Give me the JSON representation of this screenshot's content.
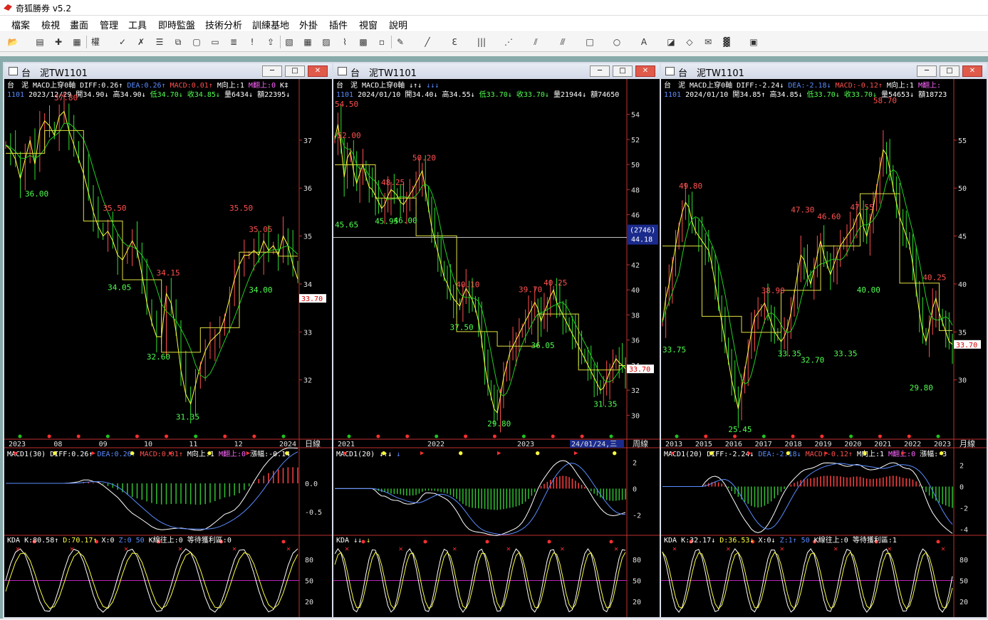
{
  "app": {
    "title": "奇狐勝券 v5.2"
  },
  "menu": [
    "檔案",
    "檢視",
    "畫面",
    "管理",
    "工具",
    "即時監盤",
    "技術分析",
    "訓練基地",
    "外掛",
    "插件",
    "視窗",
    "說明"
  ],
  "toolbar": {
    "icons": [
      "open-icon",
      "table-icon",
      "crosshair-icon",
      "layout-icon",
      "weight-icon",
      "draw-icon",
      "compare-icon",
      "list-icon",
      "copy-icon",
      "doc-icon",
      "alert-icon",
      "stack-icon",
      "warning-icon",
      "export-icon",
      "chart1-icon",
      "grid-icon",
      "chart2-icon",
      "line-chart-icon",
      "chart3-icon",
      "chart4-icon",
      "pen-icon",
      "line-icon",
      "fib-icon",
      "vline-icon",
      "fan-icon",
      "channel-icon",
      "parallel-icon",
      "rect-icon",
      "ellipse-icon",
      "text-icon",
      "eraser-icon",
      "erase2-icon",
      "note-icon",
      "palette-icon",
      "save-icon"
    ],
    "weight_label": "權"
  },
  "windows": [
    {
      "title": "台　泥TW1101",
      "buttons": {
        "min": "─",
        "max": "□",
        "close": "✕"
      },
      "price_info": {
        "name": "台　泥",
        "indicator": "MACD上穿0軸",
        "diff": "DIFF:0.26↑",
        "dea": "DEA:0.26↑",
        "macd": "MACD:0.01↑",
        "m_up": "M向上:1",
        "m_turn": "M翻上:0",
        "k": "K‡",
        "code": "1101",
        "date": "2023/12/29",
        "open": "開34.90↓",
        "high": "高34.90↓",
        "low": "低34.70↓",
        "close": "收34.85↓",
        "vol": "量6434↓",
        "amt": "額22395↓"
      },
      "period_label": "日線",
      "x_labels": [
        "2023",
        "08",
        "09",
        "10",
        "11",
        "12",
        "2024"
      ],
      "y_ticks": [
        "37",
        "36",
        "35",
        "34",
        "33",
        "32"
      ],
      "y_values": [
        37,
        36,
        35,
        34,
        33,
        32
      ],
      "ylim": [
        31.0,
        37.8
      ],
      "current_price": "33.70",
      "price_annotations": [
        {
          "t": "37.80",
          "v": 37.8,
          "i": 12,
          "c": "#ff5050"
        },
        {
          "t": "36.00",
          "v": 36.0,
          "i": 6,
          "c": "#50ff50"
        },
        {
          "t": "35.50",
          "v": 35.5,
          "i": 22,
          "c": "#ff5050"
        },
        {
          "t": "35.50",
          "v": 35.5,
          "i": 48,
          "c": "#ff5050"
        },
        {
          "t": "35.05",
          "v": 35.05,
          "i": 52,
          "c": "#ff5050"
        },
        {
          "t": "34.15",
          "v": 34.15,
          "i": 33,
          "c": "#ff5050"
        },
        {
          "t": "34.05",
          "v": 34.05,
          "i": 23,
          "c": "#50ff50"
        },
        {
          "t": "34.00",
          "v": 34.0,
          "i": 52,
          "c": "#50ff50"
        },
        {
          "t": "32.60",
          "v": 32.6,
          "i": 31,
          "c": "#50ff50"
        },
        {
          "t": "31.35",
          "v": 31.35,
          "i": 37,
          "c": "#50ff50"
        }
      ],
      "series": [
        36.9,
        36.8,
        36.6,
        36.2,
        36.6,
        37.0,
        36.5,
        37.2,
        37.4,
        37.3,
        37.1,
        37.5,
        37.6,
        37.2,
        36.9,
        36.6,
        36.3,
        35.9,
        35.5,
        35.2,
        35.0,
        35.1,
        34.9,
        34.6,
        34.5,
        34.7,
        34.9,
        34.7,
        34.2,
        33.6,
        33.2,
        32.9,
        32.9,
        33.8,
        33.6,
        33.0,
        32.2,
        31.7,
        31.5,
        31.9,
        32.3,
        32.6,
        32.8,
        32.9,
        33.0,
        33.3,
        33.7,
        34.1,
        34.4,
        34.6,
        34.6,
        34.7,
        34.6,
        34.9,
        34.7,
        34.8,
        34.6,
        35.0,
        34.8,
        34.4,
        34.1
      ],
      "macd_header": {
        "name": "MACD1(30)",
        "diff": "DIFF:0.26↑",
        "dea": "DEA:0.26↑",
        "macd": "MACD:0.01↑",
        "m_up": "M向上:1",
        "m_turn": "M翻上:0",
        "amp": "漲幅:-0.14"
      },
      "macd_ticks": [
        "0.0",
        "-0.5"
      ],
      "macd_vals": [
        0.0,
        -0.5
      ],
      "macd_lim": [
        -0.9,
        0.6
      ],
      "kd_header": {
        "name": "KDA",
        "k": "K:80.58↑",
        "d": "D:70.17↑",
        "x": "X:0",
        "z": "Z:0",
        "n50": "50",
        "up": "K線往上:0",
        "wait": "等待獲利區:0"
      },
      "kd_ticks": [
        "80",
        "50",
        "20"
      ]
    },
    {
      "title": "台　泥TW1101",
      "buttons": {
        "min": "─",
        "max": "□",
        "close": "✕"
      },
      "price_info": {
        "name": "台　泥",
        "indicator": "MACD上穿0軸",
        "diff": "↓↑↓",
        "dea": "↓↓↓",
        "macd": "",
        "m_up": "",
        "m_turn": "",
        "k": "",
        "code": "1101",
        "date": "2024/01/10",
        "open": "開34.40↓",
        "high": "高34.55↓",
        "low": "低33.70↓",
        "close": "收33.70↓",
        "vol": "量21944↓",
        "amt": "額74650"
      },
      "period_label": "周線",
      "x_labels": [
        "2021",
        "2022",
        "2023",
        "24/01/24,三"
      ],
      "y_ticks": [
        "54",
        "52",
        "50",
        "48",
        "46",
        "44",
        "42",
        "40",
        "38",
        "36",
        "34",
        "32",
        "30"
      ],
      "y_values": [
        54,
        52,
        50,
        48,
        46,
        44,
        42,
        40,
        38,
        36,
        34,
        32,
        30
      ],
      "ylim": [
        29.0,
        55.0
      ],
      "current_price": "33.70",
      "cursor_value": "(2746)",
      "cursor_price": "44.18",
      "price_annotations": [
        {
          "t": "54.50",
          "v": 54.5,
          "i": 2,
          "c": "#ff5050"
        },
        {
          "t": "52.00",
          "v": 52.0,
          "i": 4,
          "c": "#ff5050"
        },
        {
          "t": "50.20",
          "v": 50.2,
          "i": 28,
          "c": "#ff5050"
        },
        {
          "t": "48.25",
          "v": 48.25,
          "i": 18,
          "c": "#ff5050"
        },
        {
          "t": "45.65",
          "v": 45.65,
          "i": 3,
          "c": "#50ff50"
        },
        {
          "t": "45.95",
          "v": 45.95,
          "i": 16,
          "c": "#50ff50"
        },
        {
          "t": "46.00",
          "v": 46.0,
          "i": 22,
          "c": "#50ff50"
        },
        {
          "t": "40.10",
          "v": 40.1,
          "i": 42,
          "c": "#ff5050"
        },
        {
          "t": "39.70",
          "v": 39.7,
          "i": 62,
          "c": "#ff5050"
        },
        {
          "t": "40.25",
          "v": 40.25,
          "i": 70,
          "c": "#ff5050"
        },
        {
          "t": "37.50",
          "v": 37.5,
          "i": 40,
          "c": "#50ff50"
        },
        {
          "t": "36.05",
          "v": 36.05,
          "i": 66,
          "c": "#50ff50"
        },
        {
          "t": "31.35",
          "v": 31.35,
          "i": 86,
          "c": "#50ff50"
        },
        {
          "t": "29.80",
          "v": 29.8,
          "i": 52,
          "c": "#50ff50"
        }
      ],
      "series": [
        52.0,
        53.2,
        51.5,
        49.0,
        50.5,
        51.0,
        49.5,
        48.5,
        49.3,
        50.0,
        49.0,
        48.2,
        48.0,
        47.5,
        47.0,
        46.5,
        46.8,
        47.5,
        48.0,
        47.8,
        47.5,
        47.0,
        46.8,
        47.2,
        47.6,
        48.0,
        48.5,
        49.0,
        49.5,
        48.0,
        46.5,
        45.0,
        44.0,
        43.0,
        42.0,
        41.0,
        40.5,
        39.8,
        39.3,
        39.0,
        38.7,
        39.5,
        40.1,
        39.7,
        39.2,
        38.5,
        37.5,
        36.0,
        34.0,
        32.5,
        31.5,
        30.5,
        30.2,
        31.5,
        33.0,
        34.0,
        35.0,
        35.5,
        36.0,
        36.5,
        37.0,
        37.5,
        38.0,
        38.5,
        39.0,
        38.5,
        37.5,
        38.2,
        38.8,
        39.5,
        40.0,
        39.0,
        38.5,
        38.0,
        37.5,
        37.0,
        36.5,
        36.0,
        35.5,
        35.0,
        34.5,
        34.0,
        33.5,
        33.0,
        32.5,
        32.0,
        32.2,
        32.8,
        33.5,
        34.0,
        34.5,
        34.2,
        34.0,
        33.7
      ],
      "macd_header": {
        "name": "MACD1(20)",
        "diff": "↓↑↓",
        "dea": "↓",
        "macd": "",
        "m_up": "",
        "m_turn": "",
        "amp": ""
      },
      "macd_ticks": [
        "2",
        "0",
        "-2"
      ],
      "macd_vals": [
        2,
        0,
        -2
      ],
      "macd_lim": [
        -3.5,
        3.0
      ],
      "kd_header": {
        "name": "KDA",
        "k": "↓↓",
        "d": "↓",
        "x": "",
        "z": "",
        "n50": "",
        "up": "",
        "wait": ""
      },
      "kd_ticks": [
        "80",
        "50",
        "20"
      ]
    },
    {
      "title": "台　泥TW1101",
      "buttons": {
        "min": "─",
        "max": "□",
        "close": "✕"
      },
      "price_info": {
        "name": "台　泥",
        "indicator": "MACD上穿0軸",
        "diff": "DIFF:-2.24↓",
        "dea": "DEA:-2.18↓",
        "macd": "MACD:-0.12↑",
        "m_up": "M向上:1",
        "m_turn": "M翻上:",
        "k": "",
        "code": "1101",
        "date": "2024/01/10",
        "open": "開34.85↑",
        "high": "高34.85↓",
        "low": "低33.70↓",
        "close": "收33.70↓",
        "vol": "量54653↓",
        "amt": "額18723"
      },
      "period_label": "月線",
      "x_labels": [
        "2013",
        "2015",
        "2016",
        "2017",
        "2018",
        "2019",
        "2020",
        "2021",
        "2022",
        "2023"
      ],
      "y_ticks": [
        "55",
        "50",
        "45",
        "40",
        "35",
        "30"
      ],
      "y_values": [
        55,
        50,
        45,
        40,
        35,
        30
      ],
      "ylim": [
        25.0,
        59.0
      ],
      "current_price": "33.70",
      "price_annotations": [
        {
          "t": "58.70",
          "v": 58.7,
          "i": 67,
          "c": "#ff5050"
        },
        {
          "t": "49.80",
          "v": 49.8,
          "i": 8,
          "c": "#ff5050"
        },
        {
          "t": "47.30",
          "v": 47.3,
          "i": 42,
          "c": "#ff5050"
        },
        {
          "t": "46.60",
          "v": 46.6,
          "i": 50,
          "c": "#ff5050"
        },
        {
          "t": "47.55",
          "v": 47.55,
          "i": 60,
          "c": "#ff5050"
        },
        {
          "t": "38.90",
          "v": 38.9,
          "i": 33,
          "c": "#ff5050"
        },
        {
          "t": "40.25",
          "v": 40.25,
          "i": 82,
          "c": "#ff5050"
        },
        {
          "t": "40.00",
          "v": 40.0,
          "i": 62,
          "c": "#50ff50"
        },
        {
          "t": "33.75",
          "v": 33.75,
          "i": 0,
          "c": "#50ff50"
        },
        {
          "t": "33.35",
          "v": 33.35,
          "i": 38,
          "c": "#50ff50"
        },
        {
          "t": "32.70",
          "v": 32.7,
          "i": 45,
          "c": "#50ff50"
        },
        {
          "t": "33.35",
          "v": 33.35,
          "i": 55,
          "c": "#50ff50"
        },
        {
          "t": "29.80",
          "v": 29.8,
          "i": 78,
          "c": "#50ff50"
        },
        {
          "t": "25.45",
          "v": 25.45,
          "i": 23,
          "c": "#50ff50"
        }
      ],
      "series": [
        36.0,
        38.5,
        40.0,
        42.0,
        44.0,
        46.0,
        47.5,
        48.5,
        48.0,
        46.5,
        45.5,
        45.0,
        44.5,
        44.0,
        43.5,
        42.0,
        40.0,
        38.0,
        36.0,
        34.0,
        32.0,
        30.0,
        28.5,
        27.0,
        29.0,
        31.0,
        33.0,
        35.0,
        36.5,
        37.0,
        37.5,
        38.0,
        37.0,
        36.0,
        35.0,
        34.5,
        34.0,
        34.5,
        35.5,
        37.0,
        39.0,
        41.0,
        43.0,
        42.5,
        41.0,
        40.0,
        41.5,
        43.0,
        44.5,
        43.0,
        42.0,
        41.0,
        42.0,
        43.0,
        44.0,
        44.5,
        45.0,
        45.5,
        46.0,
        47.0,
        47.5,
        46.0,
        45.0,
        46.5,
        48.0,
        50.0,
        52.0,
        54.0,
        53.5,
        52.0,
        50.0,
        48.5,
        47.0,
        46.0,
        45.0,
        44.0,
        42.0,
        39.5,
        37.0,
        35.0,
        34.0,
        35.5,
        37.5,
        38.5,
        37.0,
        36.0,
        35.0,
        34.0,
        33.7
      ],
      "macd_header": {
        "name": "MACD1(20)",
        "diff": "DIFF:-2.24↓",
        "dea": "DEA:-2.18↓",
        "macd": "MACD:-0.12↑",
        "m_up": "M向上:1",
        "m_turn": "M翻上:0",
        "amp": "漲幅:-3"
      },
      "macd_ticks": [
        "2",
        "0",
        "-2",
        "-4"
      ],
      "macd_vals": [
        2,
        0,
        -2,
        -4
      ],
      "macd_lim": [
        -4.5,
        3.5
      ],
      "kd_header": {
        "name": "KDA",
        "k": "K:32.17↓",
        "d": "D:36.53↓",
        "x": "X:0↓",
        "z": "Z:1↑",
        "n50": "50",
        "up": "K線往上:0",
        "wait": "等待獲利區:1"
      },
      "kd_ticks": [
        "80",
        "50",
        "20"
      ]
    }
  ]
}
